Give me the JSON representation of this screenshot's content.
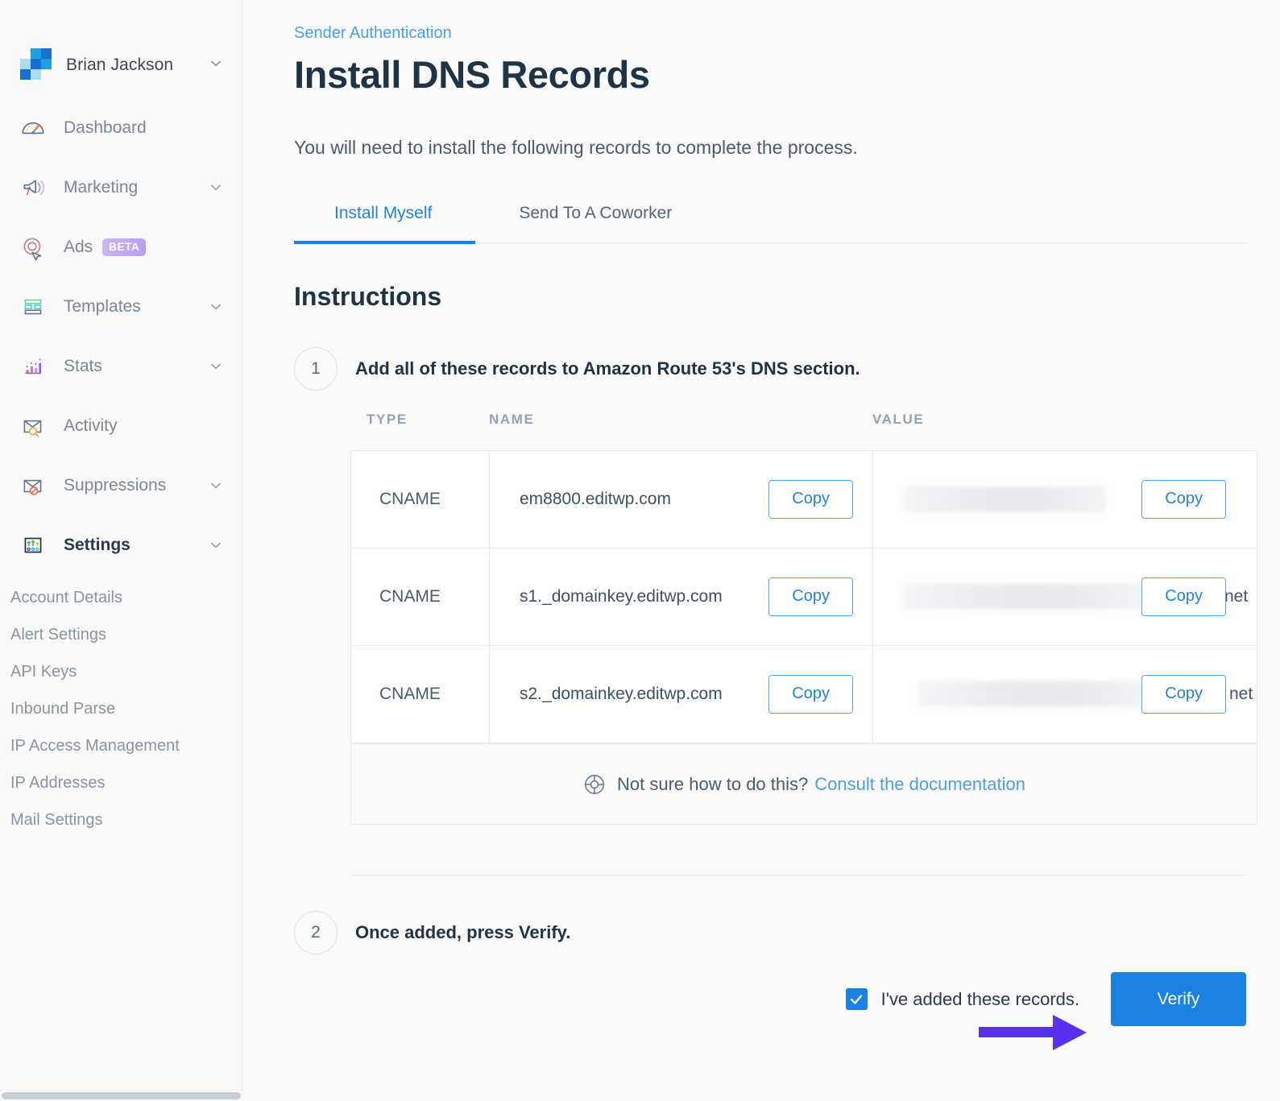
{
  "sidebar": {
    "account": {
      "name": "Brian Jackson",
      "chevron_icon": "chevron-down-icon",
      "logo_icon": "sendgrid-logo-icon"
    },
    "items": [
      {
        "label": "Dashboard",
        "icon": "speedometer-icon",
        "expandable": false
      },
      {
        "label": "Marketing",
        "icon": "megaphone-icon",
        "expandable": true
      },
      {
        "label": "Ads",
        "icon": "ad-cursor-icon",
        "expandable": false,
        "badge": "BETA"
      },
      {
        "label": "Templates",
        "icon": "layout-template-icon",
        "expandable": true
      },
      {
        "label": "Stats",
        "icon": "bar-chart-icon",
        "expandable": true
      },
      {
        "label": "Activity",
        "icon": "envelope-search-icon",
        "expandable": false
      },
      {
        "label": "Suppressions",
        "icon": "envelope-block-icon",
        "expandable": true
      },
      {
        "label": "Settings",
        "icon": "sliders-icon",
        "expandable": true,
        "active": true
      }
    ],
    "settings_sub_items": [
      {
        "label": "Account Details"
      },
      {
        "label": "Alert Settings"
      },
      {
        "label": "API Keys"
      },
      {
        "label": "Inbound Parse"
      },
      {
        "label": "IP Access Management"
      },
      {
        "label": "IP Addresses"
      },
      {
        "label": "Mail Settings"
      }
    ]
  },
  "main": {
    "breadcrumb": "Sender Authentication",
    "title": "Install DNS Records",
    "subtitle": "You will need to install the following records to complete the process.",
    "tabs": [
      {
        "label": "Install Myself",
        "active": true
      },
      {
        "label": "Send To A Coworker",
        "active": false
      }
    ],
    "instructions_heading": "Instructions",
    "step1": {
      "number": "1",
      "text": "Add all of these records to Amazon Route 53's DNS section."
    },
    "table": {
      "headers": {
        "type": "TYPE",
        "name": "NAME",
        "value": "VALUE"
      },
      "copy_label": "Copy",
      "rows": [
        {
          "type": "CNAME",
          "name": "em8800.editwp.com",
          "value": "",
          "value_redacted": true,
          "value_tail": "",
          "redacted_width": 250
        },
        {
          "type": "CNAME",
          "name": "s1._domainkey.editwp.com",
          "value": "",
          "value_redacted": true,
          "value_tail": "net",
          "redacted_width": 302
        },
        {
          "type": "CNAME",
          "name": "s2._domainkey.editwp.com",
          "value": "",
          "value_redacted": true,
          "value_tail": "net",
          "redacted_width": 290
        }
      ],
      "footer": {
        "icon": "lifebuoy-icon",
        "text": "Not sure how to do this?",
        "link": "Consult the documentation"
      }
    },
    "step2": {
      "number": "2",
      "text": "Once added, press Verify."
    },
    "checkbox": {
      "checked": true,
      "label": "I've added these records."
    },
    "verify_button": "Verify"
  },
  "annotations": [
    {
      "name": "arrow-down-to-verify",
      "direction": "down",
      "color": "#5930EF"
    },
    {
      "name": "arrow-right-to-checkbox",
      "direction": "right",
      "color": "#5930EF"
    }
  ],
  "colors": {
    "accent_blue": "#1A82E2",
    "link_blue": "#4A9EF0",
    "annotation_purple": "#5930EF",
    "heading_navy": "#1F3346",
    "sidebar_bg": "#FAFAFB"
  }
}
